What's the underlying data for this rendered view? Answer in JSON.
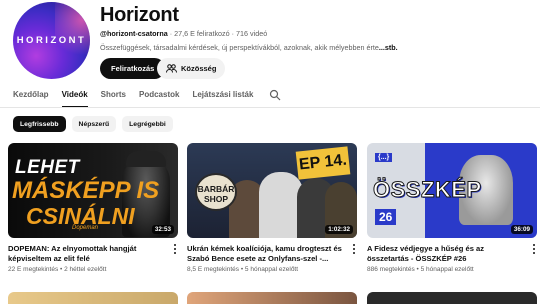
{
  "channel": {
    "avatar_text": "HORIZONT",
    "name": "Horizont",
    "handle": "@horizont-csatorna",
    "subscribers": "27,6 E feliratkozó",
    "videos": "716 videó",
    "description": "Összefüggések, társadalmi kérdések, új perspektívákból,  azoknak, akik mélyebben érte",
    "more": "...stb.",
    "subscribe_label": "Feliratkozás",
    "community_label": "Közösség"
  },
  "tabs": [
    {
      "label": "Kezdőlap",
      "active": false
    },
    {
      "label": "Videók",
      "active": true
    },
    {
      "label": "Shorts",
      "active": false
    },
    {
      "label": "Podcastok",
      "active": false
    },
    {
      "label": "Lejátszási listák",
      "active": false
    }
  ],
  "chips": [
    {
      "label": "Legfrissebb",
      "active": true
    },
    {
      "label": "Népszerű",
      "active": false
    },
    {
      "label": "Legrégebbi",
      "active": false
    }
  ],
  "videos": [
    {
      "title": "DOPEMAN: Az elnyomottak hangját képviseltem az elit felé",
      "views": "22 E megtekintés",
      "age": "2 héttel ezelőtt",
      "duration": "32:53",
      "thumb_lines": [
        "LEHET",
        "MÁSKÉPP IS",
        "CSINÁLNI",
        "Dopeman"
      ]
    },
    {
      "title": "Ukrán kémek koalíciója, kamu drogteszt és Szabó Bence esete az Onlyfans-szel -...",
      "views": "8,5 E megtekintés",
      "age": "5 hónappal ezelőtt",
      "duration": "1:02:32",
      "thumb_lines": [
        "BARBÁR SHOP",
        "EP 14."
      ]
    },
    {
      "title": "A Fidesz védjegye a hűség és az összetartás - ÖSSZKÉP #26",
      "views": "886 megtekintés",
      "age": "5 hónappal ezelőtt",
      "duration": "36:09",
      "thumb_lines": [
        "{...}",
        "ÖSSZKÉP",
        "26"
      ]
    }
  ],
  "colors": {
    "accent_dark": "#0f0f0f",
    "secondary_text": "#606060",
    "chip_bg": "#f2f2f2",
    "brand_orange": "#f0a020",
    "osszkep_blue": "#2a3ac9"
  }
}
